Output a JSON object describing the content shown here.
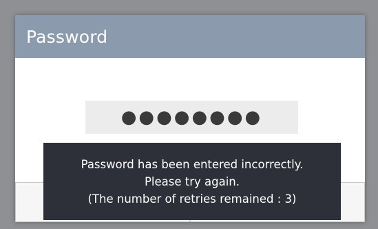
{
  "dialog": {
    "title": "Password",
    "password_masked": "●●●●●●●●"
  },
  "toast": {
    "line1": "Password has been entered incorrectly.",
    "line2": "Please try again.",
    "line3": "(The number of retries remained : 3)"
  },
  "colors": {
    "header_bg": "#8b9aac",
    "toast_bg": "#2d3038",
    "screen_bg": "#8f9093"
  }
}
